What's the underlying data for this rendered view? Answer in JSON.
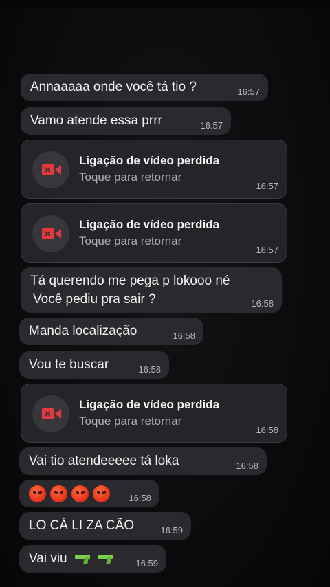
{
  "messages": [
    {
      "text": "Annaaaaa onde você tá tio ?",
      "time": "16:57"
    },
    {
      "text": "Vamo atende essa prrr",
      "time": "16:57"
    },
    {
      "call_title": "Ligação de vídeo perdida",
      "call_sub": "Toque para retornar",
      "time": "16:57"
    },
    {
      "call_title": "Ligação de vídeo perdida",
      "call_sub": "Toque para retornar",
      "time": "16:57"
    },
    {
      "line1": "Tá querendo me pega p lokooo né",
      "line2": "Você pediu pra sair ?",
      "time": "16:58"
    },
    {
      "text": "Manda localização",
      "time": "16:58"
    },
    {
      "text": "Vou te buscar",
      "time": "16:58"
    },
    {
      "call_title": "Ligação de vídeo perdida",
      "call_sub": "Toque para retornar",
      "time": "16:58"
    },
    {
      "text": "Vai tio atendeeeee tá loka",
      "time": "16:58"
    },
    {
      "emoji": "angry-face",
      "emoji_count": 4,
      "time": "16:58"
    },
    {
      "text": "LO CÁ LI ZA CÃO",
      "time": "16:59"
    },
    {
      "text": "Vai viu",
      "emoji": "water-pistol",
      "emoji_count": 2,
      "time": "16:59"
    }
  ],
  "colors": {
    "background": "#0b0b0d",
    "bubble": "#2a2a2e",
    "call_bubble": "#252529",
    "call_icon_red": "#e5373d",
    "text": "#f2f2f2",
    "timestamp": "#b8b8bc"
  },
  "icons": {
    "missed_call": "video-camera-icon"
  }
}
